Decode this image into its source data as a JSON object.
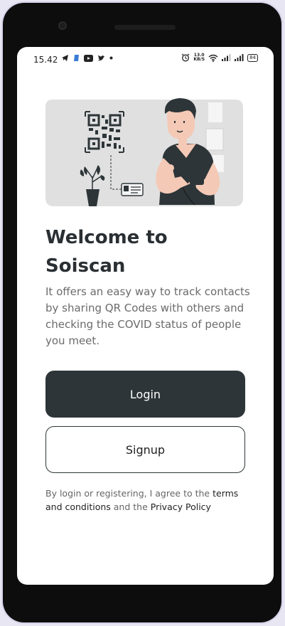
{
  "status_bar": {
    "time": "15.42",
    "left_icons": [
      "telegram-icon",
      "app-icon",
      "youtube-icon",
      "twitter-icon",
      "dot-icon"
    ],
    "right_icons": [
      "alarm-icon",
      "wifi-icon",
      "signal-icon",
      "signal-icon",
      "battery-icon"
    ],
    "speed_value": "13.0",
    "speed_unit": "KB/S",
    "battery_level": "84"
  },
  "hero": {
    "illustration": "person-scanning-qr-code-illustration"
  },
  "welcome": {
    "title_line1": "Welcome to",
    "title_line2": "Soiscan",
    "description": "It offers an easy way to track contacts by sharing QR Codes with others and checking the COVID status of people you meet."
  },
  "buttons": {
    "login_label": "Login",
    "signup_label": "Signup"
  },
  "terms": {
    "prefix": "By login or registering, I agree to the ",
    "terms_link": "terms and conditions",
    "middle": " and the ",
    "privacy_link": "Privacy Policy"
  },
  "colors": {
    "primary": "#2d3538",
    "text_dark": "#2a2f33",
    "text_muted": "#6b6b6b",
    "illustration_bg": "#e0e0e0",
    "skin": "#f4c9b6"
  }
}
